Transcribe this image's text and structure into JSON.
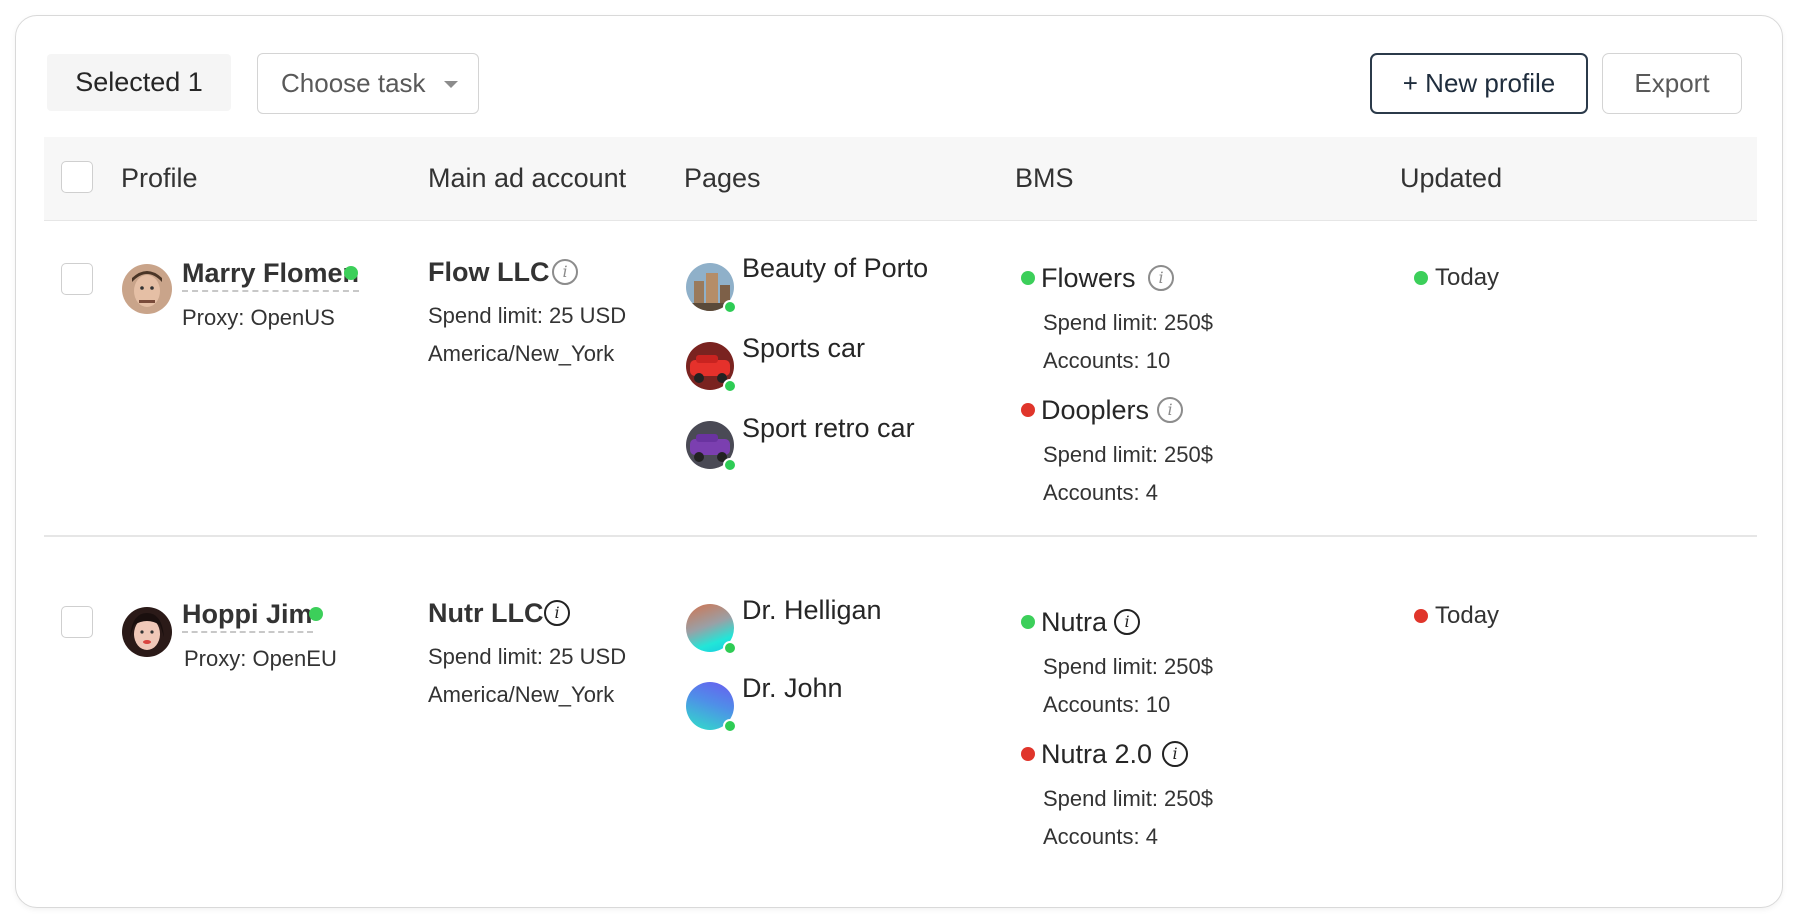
{
  "toolbar": {
    "selected_label": "Selected 1",
    "task_select_placeholder": "Choose task",
    "new_profile_label": "+ New profile",
    "export_label": "Export"
  },
  "table": {
    "columns": [
      "Profile",
      "Main ad account",
      "Pages",
      "BMS",
      "Updated"
    ]
  },
  "colors": {
    "online": "#3ccf5a",
    "offline": "#e0352b",
    "primary_border": "#2b3a4a"
  },
  "rows": [
    {
      "profile": {
        "name": "Marry Flomen",
        "proxy": "Proxy: OpenUS",
        "status": "online"
      },
      "ad_account": {
        "name": "Flow LLC",
        "spend": "Spend limit: 25 USD",
        "timezone": "America/New_York"
      },
      "pages": [
        {
          "name": "Beauty of Porto",
          "icon": "city-photo"
        },
        {
          "name": "Sports car",
          "icon": "red-car-photo"
        },
        {
          "name": "Sport retro car",
          "icon": "purple-car-photo"
        }
      ],
      "bms": [
        {
          "name": "Flowers",
          "status": "online",
          "spend": "Spend limit: 250$",
          "accounts": "Accounts: 10"
        },
        {
          "name": "Dooplers",
          "status": "offline",
          "spend": "Spend limit: 250$",
          "accounts": "Accounts: 4"
        }
      ],
      "updated": {
        "text": "Today",
        "status": "online"
      }
    },
    {
      "profile": {
        "name": "Hoppi Jim",
        "proxy": "Proxy: OpenEU",
        "status": "online"
      },
      "ad_account": {
        "name": "Nutr LLC",
        "spend": "Spend limit: 25 USD",
        "timezone": "America/New_York"
      },
      "pages": [
        {
          "name": "Dr. Helligan",
          "icon": "gradient-avatar"
        },
        {
          "name": "Dr. John",
          "icon": "gradient-avatar"
        }
      ],
      "bms": [
        {
          "name": "Nutra",
          "status": "online",
          "spend": "Spend limit: 250$",
          "accounts": "Accounts: 10"
        },
        {
          "name": "Nutra 2.0",
          "status": "offline",
          "spend": "Spend limit: 250$",
          "accounts": "Accounts: 4"
        }
      ],
      "updated": {
        "text": "Today",
        "status": "offline"
      }
    }
  ]
}
